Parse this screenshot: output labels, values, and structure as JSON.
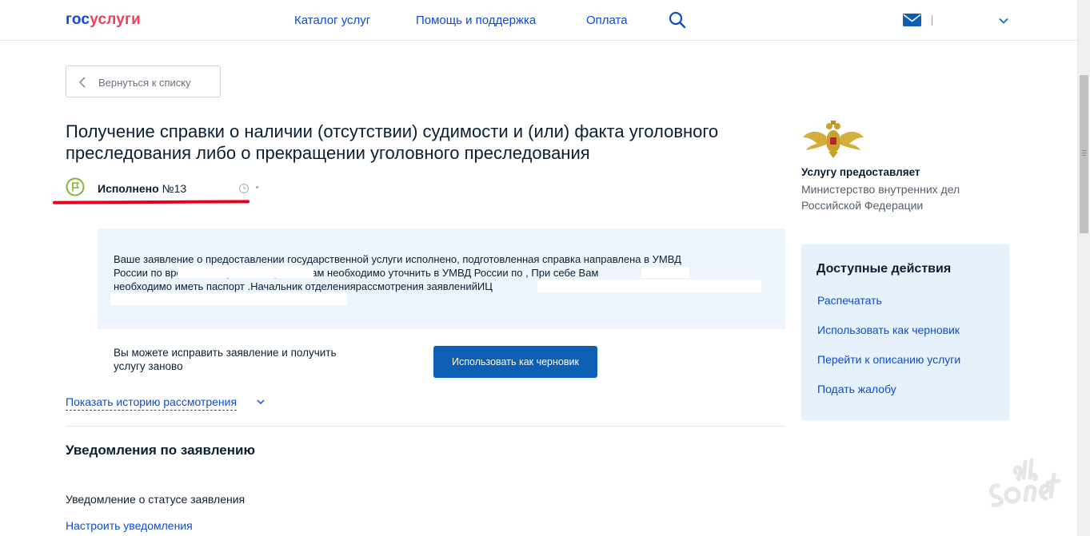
{
  "header": {
    "logo_part1": "гос",
    "logo_part2": "услуги",
    "nav": [
      "Каталог услуг",
      "Помощь и поддержка",
      "Оплата"
    ]
  },
  "back_button": {
    "label": "Вернуться к списку"
  },
  "page_title": "Получение справки о наличии (отсутствии) судимости и (или) факта уголовного преследования либо о прекращении уголовного преследования",
  "status": {
    "label": "Исполнено",
    "number": "№13"
  },
  "info": {
    "line1": "Ваше заявление о предоставлении государственной услуги исполнено, подготовленная справка направлена в УМВД",
    "line2": "России по                               времени получения справки Вам необходимо уточнить в УМВД России по              , При себе Вам",
    "line3": "необходимо иметь паспорт .Начальник отделениярассмотрения заявленийИЦ"
  },
  "draft": {
    "text": "Вы можете исправить заявление и получить услугу заново",
    "button_label": "Использовать как черновик"
  },
  "history_link": "Показать историю рассмотрения",
  "notifications": {
    "heading": "Уведомления по заявлению",
    "status_label": "Уведомление о статусе заявления",
    "setup_link": "Настроить уведомления"
  },
  "provider": {
    "label": "Услугу предоставляет",
    "name": "Министерство внутренних дел Российской Федерации"
  },
  "actions": {
    "title": "Доступные действия",
    "items": [
      "Распечатать",
      "Использовать как черновик",
      "Перейти к описанию услуги",
      "Подать жалобу"
    ]
  },
  "colors": {
    "brand_blue": "#0d4cd3",
    "brand_red": "#ee3f58",
    "button_blue": "#0d5fb3",
    "status_green": "#8ab133",
    "highlight_red": "#e3001b",
    "info_bg": "#edf4fb",
    "actions_bg": "#e5f1fb"
  },
  "icons": [
    "search-icon",
    "mail-icon",
    "chevron-down-icon",
    "chevron-left-icon",
    "flag-icon",
    "clock-icon",
    "emblem-icon",
    "watermark-logo"
  ]
}
